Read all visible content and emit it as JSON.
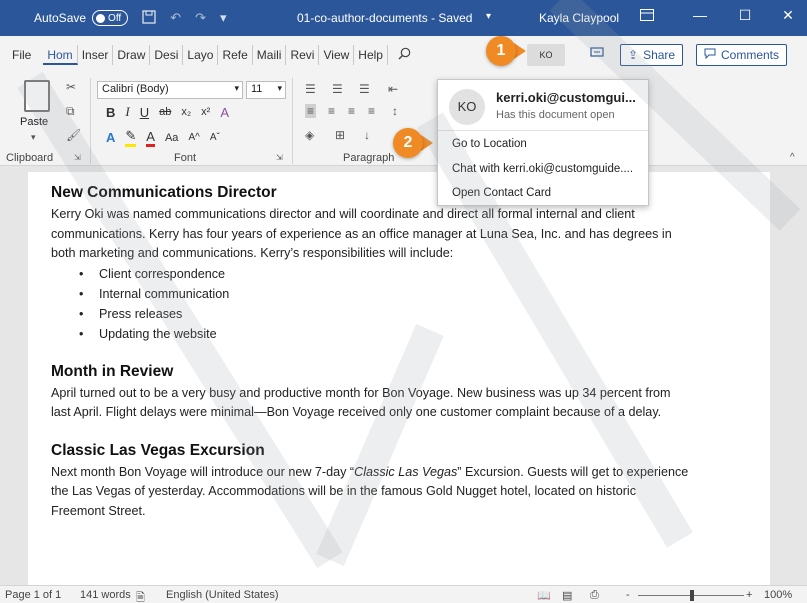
{
  "titlebar": {
    "autosave_label": "AutoSave",
    "autosave_state": "Off",
    "doc_title": "01-co-author-documents - Saved",
    "user_name": "Kayla Claypool"
  },
  "tabs": [
    {
      "label": "File"
    },
    {
      "label": "Hom"
    },
    {
      "label": "Inser"
    },
    {
      "label": "Draw"
    },
    {
      "label": "Desi"
    },
    {
      "label": "Layo"
    },
    {
      "label": "Refe"
    },
    {
      "label": "Maili"
    },
    {
      "label": "Revi"
    },
    {
      "label": "View"
    },
    {
      "label": "Help"
    }
  ],
  "header": {
    "coauthor_initials": "KO",
    "share_label": "Share",
    "comments_label": "Comments"
  },
  "ribbon": {
    "paste_label": "Paste",
    "font_name": "Calibri (Body)",
    "font_size": "11",
    "groups": {
      "clipboard": "Clipboard",
      "font": "Font",
      "paragraph": "Paragraph"
    }
  },
  "popup": {
    "initials": "KO",
    "email": "kerri.oki@customgui...",
    "subtitle": "Has this document open",
    "go_to_location": "Go to Location",
    "chat": "Chat with kerri.oki@customguide....",
    "open_contact": "Open Contact Card"
  },
  "badges": {
    "step1": "1",
    "step2": "2"
  },
  "document": {
    "h1": "New Communications Director",
    "p1": "Kerry Oki was named communications director and will coordinate and direct all formal internal and client communications. Kerry has four years of experience as an office manager at Luna Sea, Inc. and has degrees in both marketing and communications. Kerry’s responsibilities will include:",
    "bullets": [
      "Client correspondence",
      "Internal communication",
      "Press releases",
      "Updating the website"
    ],
    "h2": "Month in Review",
    "p2": "April turned out to be a very busy and productive month for Bon Voyage. New business was up 34 percent from last April. Flight delays were minimal—Bon Voyage received only one customer complaint because of a delay.",
    "h3": "Classic Las Vegas Excursion",
    "p3_before": "Next month Bon Voyage will introduce our new 7-day “",
    "p3_italic": "Classic Las Vegas",
    "p3_after": "” Excursion. Guests will get to experience the Las Vegas of yesterday. Accommodations will be in the famous Gold Nugget hotel, located on historic Freemont Street."
  },
  "statusbar": {
    "page": "Page 1 of 1",
    "words": "141 words",
    "language": "English (United States)",
    "zoom": "100%",
    "zoom_minus": "-",
    "zoom_plus": "+"
  },
  "colors": {
    "titlebar": "#2b579a",
    "accent": "#2b579a",
    "badge": "#f08a24"
  }
}
